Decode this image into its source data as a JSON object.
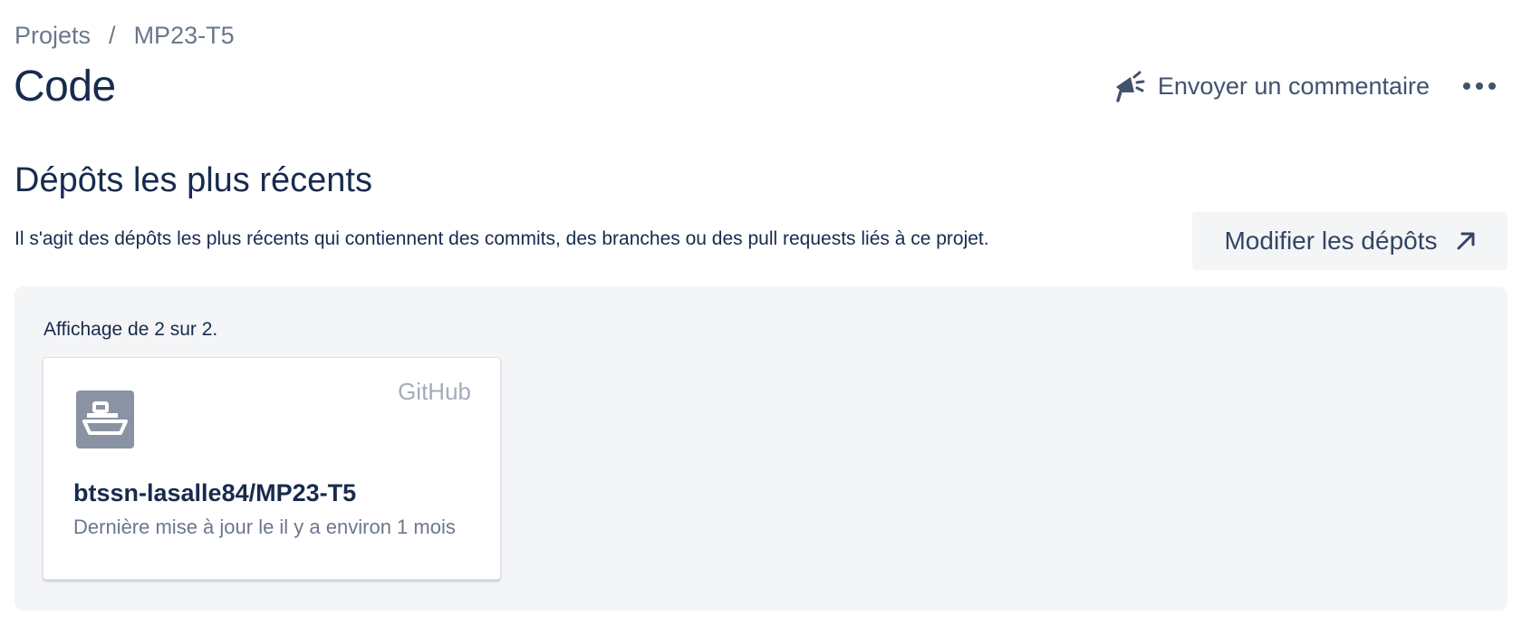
{
  "breadcrumb": {
    "items": [
      "Projets",
      "MP23-T5"
    ],
    "separator": "/"
  },
  "page": {
    "title": "Code"
  },
  "header": {
    "feedback_label": "Envoyer un commentaire",
    "feedback_icon": "megaphone-icon",
    "more_icon": "more-horizontal-icon"
  },
  "section": {
    "title": "Dépôts les plus récents",
    "description": "Il s'agit des dépôts les plus récents qui contiennent des commits, des branches ou des pull requests liés à ce projet.",
    "edit_button_label": "Modifier les dépôts",
    "edit_button_icon": "arrow-up-right-icon"
  },
  "repositories": {
    "count_text": "Affichage de 2 sur 2.",
    "items": [
      {
        "provider": "GitHub",
        "name": "btssn-lasalle84/MP23-T5",
        "updated": "Dernière mise à jour le il y a environ 1 mois",
        "icon": "ship-icon"
      }
    ]
  },
  "colors": {
    "text_primary": "#172b4d",
    "text_subtle": "#6b778c",
    "panel_background": "#f4f5f7",
    "avatar_background": "#8993a4"
  }
}
